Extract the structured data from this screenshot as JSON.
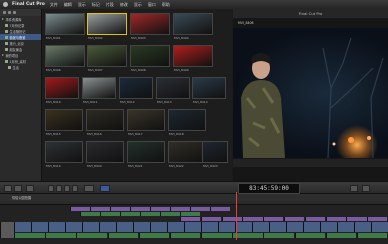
{
  "menubar": {
    "app_name": "Final Cut Pro",
    "items": [
      "文件",
      "编辑",
      "显示",
      "标记",
      "片段",
      "修改",
      "显示",
      "窗口",
      "帮助"
    ]
  },
  "libraries": {
    "rows": [
      {
        "label": "事件资源库",
        "indent": 0,
        "selected": false
      },
      {
        "label": "7月份记录",
        "indent": 1,
        "selected": false
      },
      {
        "label": "生活随拍记",
        "indent": 1,
        "selected": false
      },
      {
        "label": "街景与夜景",
        "indent": 1,
        "selected": true
      },
      {
        "label": "旅行_北京",
        "indent": 1,
        "selected": false
      },
      {
        "label": "朋友聚会",
        "indent": 1,
        "selected": false
      },
      {
        "label": "我的项目",
        "indent": 0,
        "selected": false
      },
      {
        "label": "1月份_素材",
        "indent": 1,
        "selected": false
      },
      {
        "label": "生活",
        "indent": 2,
        "selected": false
      }
    ]
  },
  "browser": {
    "clips": [
      {
        "caption": "MVI_8401",
        "color": "#7d8d8f",
        "selected": false
      },
      {
        "caption": "MVI_8402",
        "color": "#9aa1a0",
        "selected": true
      },
      {
        "caption": "MVI_8403",
        "color": "#a02828",
        "selected": false
      },
      {
        "caption": "MVI_8404",
        "color": "#3a4a55",
        "selected": false
      },
      {
        "caption": "MVI_8406",
        "color": "#6a7a6a",
        "selected": false
      },
      {
        "caption": "MVI_8407",
        "color": "#4a5a3a",
        "selected": false
      },
      {
        "caption": "MVI_8408",
        "color": "#2a3a22",
        "selected": false
      },
      {
        "caption": "MVI_8409",
        "color": "#b01e1e",
        "selected": false
      },
      {
        "caption": "MVI_8410",
        "color": "#a11a1a",
        "selected": false
      },
      {
        "caption": "MVI_8411",
        "color": "#8a9090",
        "selected": false
      },
      {
        "caption": "MVI_8412",
        "color": "#1c2a3a",
        "selected": false
      },
      {
        "caption": "MVI_8413",
        "color": "#2a2f35",
        "selected": false
      },
      {
        "caption": "MVI_8414",
        "color": "#2a3a4a",
        "selected": false
      },
      {
        "caption": "MVI_8415",
        "color": "#3a3020",
        "selected": false
      },
      {
        "caption": "MVI_8416",
        "color": "#2c2a22",
        "selected": false
      },
      {
        "caption": "MVI_8417",
        "color": "#3a342a",
        "selected": false
      },
      {
        "caption": "MVI_8418",
        "color": "#1c2830",
        "selected": false
      },
      {
        "caption": "MVI_8419",
        "color": "#2c3234",
        "selected": false
      },
      {
        "caption": "MVI_8420",
        "color": "#2a2a2e",
        "selected": false
      },
      {
        "caption": "MVI_8421",
        "color": "#24302a",
        "selected": false
      },
      {
        "caption": "MVI_8422",
        "color": "#302e26",
        "selected": false
      },
      {
        "caption": "MVI_8423",
        "color": "#1f2630",
        "selected": false
      }
    ]
  },
  "viewer": {
    "title": "Final Cut Pro",
    "clip_name": "MVI_8406"
  },
  "toolbar": {
    "timecode": "83:45:59:00"
  },
  "timeline": {
    "project_name": "情侣公园拍摄"
  },
  "colors": {
    "selection": "#3f5a86",
    "clip_blue": "#4a5f86",
    "audio_green": "#3f7a4a",
    "title_purple": "#7a5aa0"
  }
}
